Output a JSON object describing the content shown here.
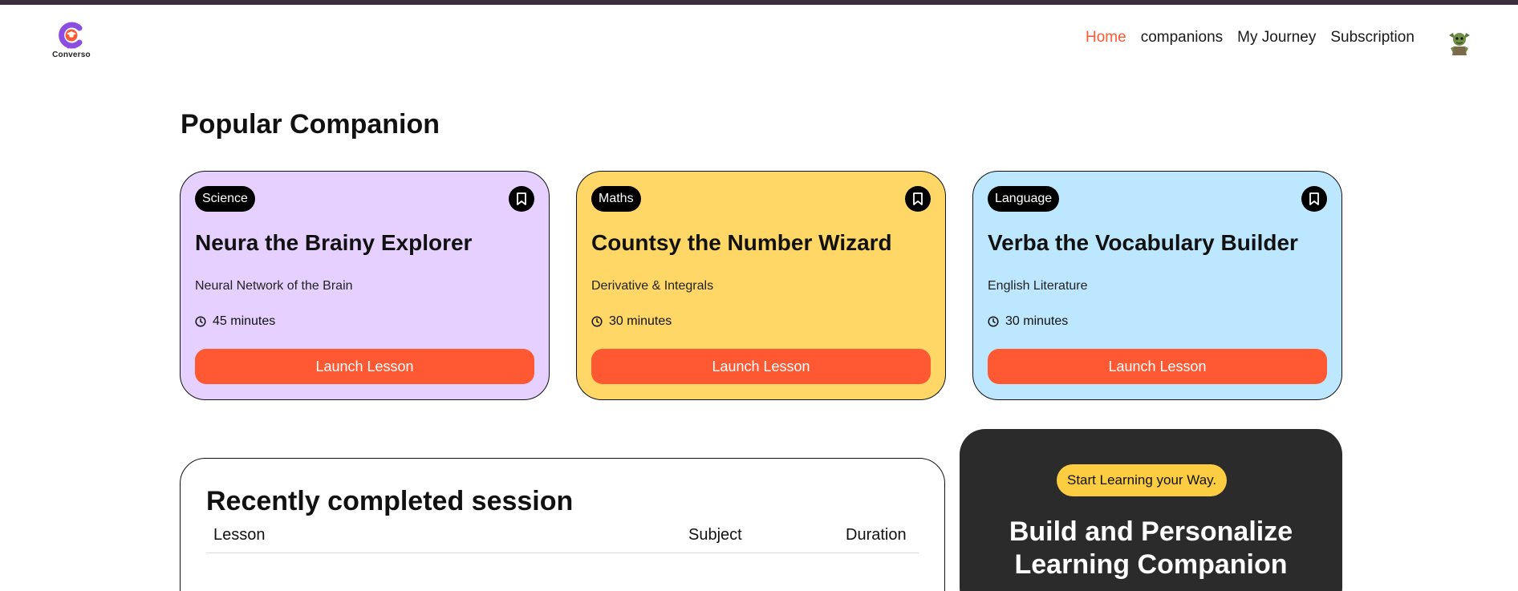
{
  "app": {
    "brand": "Converso",
    "accent": "#fe5933"
  },
  "nav": {
    "links": [
      {
        "label": "Home",
        "active": true
      },
      {
        "label": "companions",
        "active": false
      },
      {
        "label": "My Journey",
        "active": false
      },
      {
        "label": "Subscription",
        "active": false
      }
    ],
    "avatar_icon": "goblin-avatar"
  },
  "popular": {
    "title": "Popular Companion",
    "cards": [
      {
        "subject": "Science",
        "name": "Neura the Brainy Explorer",
        "topic": "Neural Network of the Brain",
        "duration": "45 minutes",
        "button": "Launch Lesson",
        "color": "#e5d0ff"
      },
      {
        "subject": "Maths",
        "name": "Countsy the Number Wizard",
        "topic": "Derivative & Integrals",
        "duration": "30 minutes",
        "button": "Launch Lesson",
        "color": "#fed766"
      },
      {
        "subject": "Language",
        "name": "Verba the Vocabulary Builder",
        "topic": "English Literature",
        "duration": "30 minutes",
        "button": "Launch Lesson",
        "color": "#bde7ff"
      }
    ]
  },
  "recent": {
    "title": "Recently completed session",
    "columns": [
      "Lesson",
      "Subject",
      "Duration"
    ]
  },
  "cta": {
    "badge": "Start Learning your Way.",
    "title_line1": "Build and Personalize",
    "title_line2": "Learning Companion"
  }
}
